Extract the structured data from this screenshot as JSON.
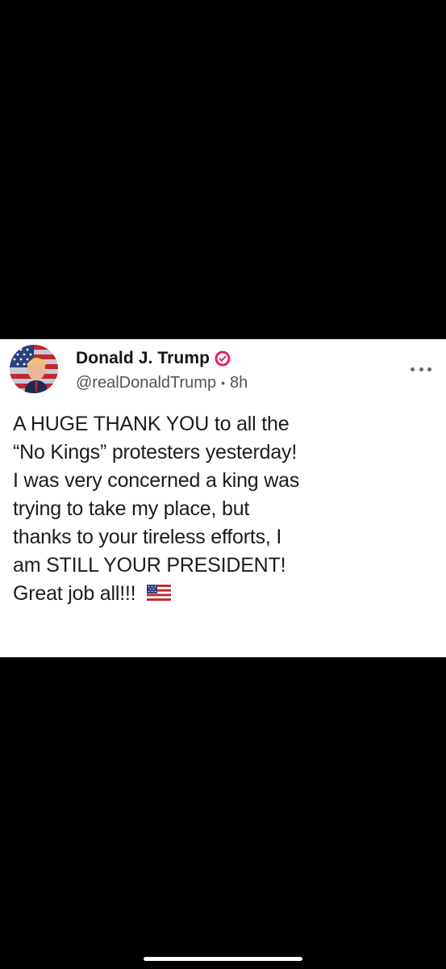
{
  "post": {
    "author_name": "Donald J. Trump",
    "handle": "@realDonaldTrump",
    "separator": "•",
    "time_ago": "8h",
    "body_lines": [
      "A HUGE THANK YOU to all the",
      "“No Kings” protesters yesterday!",
      "I was very concerned a king was",
      "trying to take my place, but",
      "thanks to your tireless efforts, I",
      "am STILL YOUR PRESIDENT!",
      "Great job all!!!"
    ],
    "emoji": "us-flag-emoji",
    "icons": {
      "avatar": "avatar-flag-portrait",
      "verified": "verified-badge-icon",
      "more": "more-options-icon"
    }
  },
  "colors": {
    "background": "#000000",
    "card": "#ffffff",
    "verified_badge": "#e0245e",
    "text_primary": "#1c1c1c",
    "text_secondary": "#545454"
  }
}
